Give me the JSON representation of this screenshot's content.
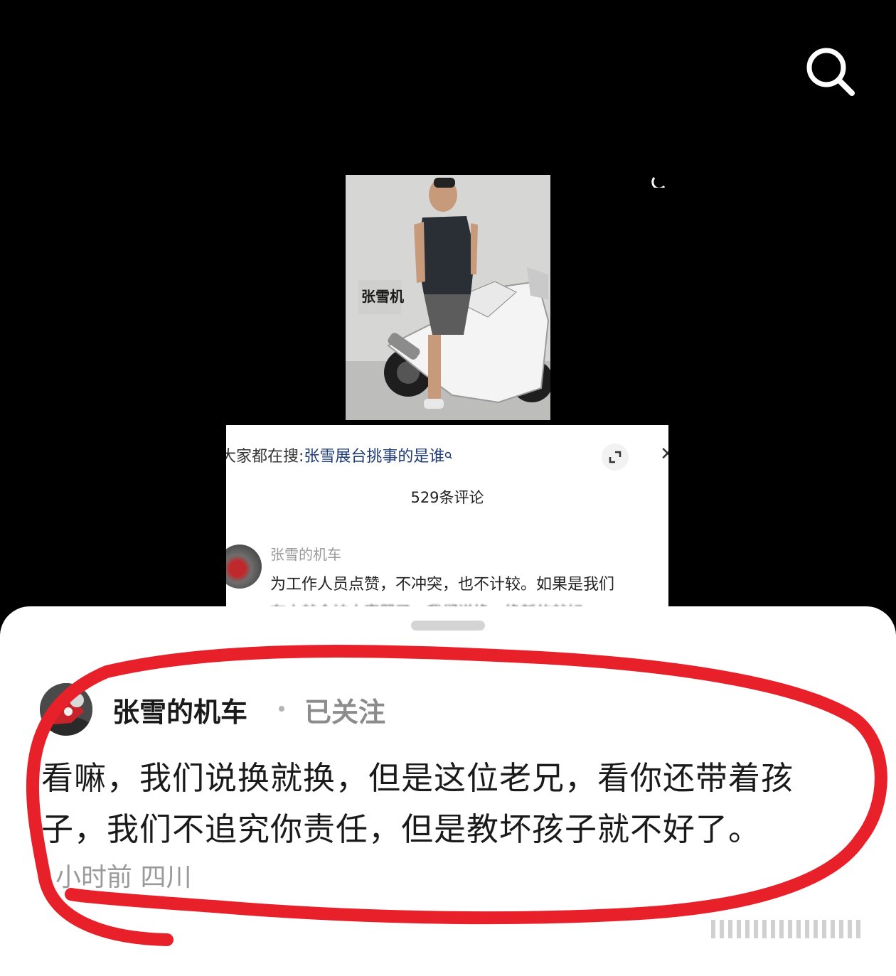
{
  "top_bar": {
    "icon": "search-icon"
  },
  "embedded_screenshot": {
    "photo_sign": "张雪机",
    "search_prefix": "大家都在搜:",
    "search_keyword": "张雪展台挑事的是谁",
    "comment_count": "529条评论",
    "comment": {
      "username": "张雪的机车",
      "text": "为工作人员点赞，不冲突，也不计较。如果是我们",
      "text_cutoff": "有人就会被人家骂了，我们说换，换新的就好"
    }
  },
  "comment_sheet": {
    "username": "张雪的机车",
    "follow_status": "已关注",
    "comment_text": "看嘛，我们说换就换，但是这位老兄，看你还带着孩子，我们不追究你责任，但是教坏孩子就不好了。",
    "time_location": "小时前 四川"
  },
  "colors": {
    "background": "#000000",
    "sheet": "#ffffff",
    "annotation": "#e8202a",
    "keyword": "#1f3b78"
  }
}
